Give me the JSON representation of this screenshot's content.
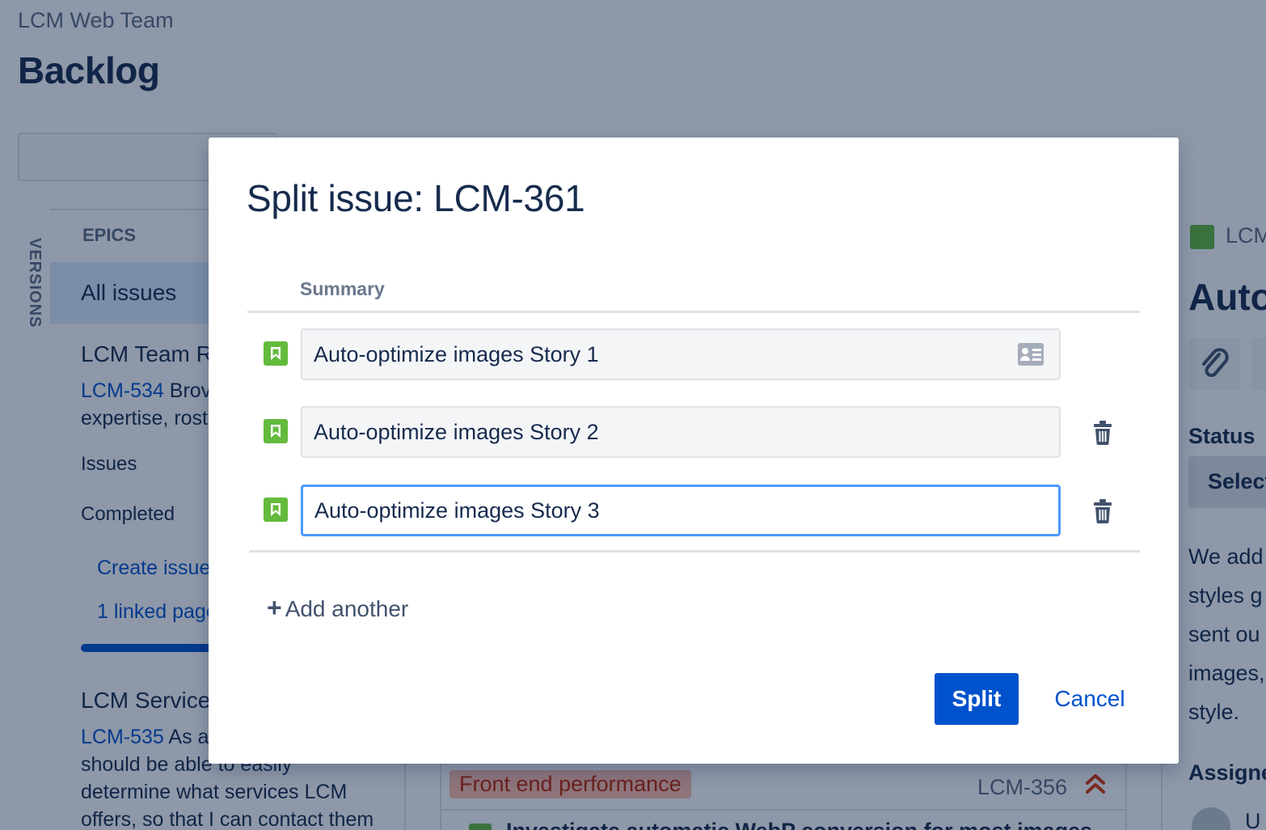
{
  "header": {
    "team": "LCM Web Team",
    "title": "Backlog"
  },
  "sidebar": {
    "versions_tab": "VERSIONS",
    "epics_heading": "EPICS",
    "all_issues": "All issues",
    "epic1": {
      "name": "LCM Team R",
      "key": "LCM-534",
      "desc_rest": " Brov",
      "desc_line2": "expertise, rost",
      "issues_label": "Issues",
      "completed_label": "Completed",
      "create_issue": "Create issue",
      "linked_pages": "1 linked page",
      "progress_fraction": 1.0
    },
    "epic2": {
      "name": "LCM Service",
      "key": "LCM-535",
      "desc_rest": " As a",
      "desc_line2": "should be able to easily",
      "desc_line3": "determine what services LCM",
      "desc_line4": "offers, so that I can contact them"
    }
  },
  "backlog_row": {
    "epic_label": "Front end performance",
    "key": "LCM-356",
    "priority_icon": "highest-priority-icon",
    "next_row_text": "Investigate automatic WebP conversion for most images"
  },
  "detail": {
    "key": "LCM",
    "title": "Auto",
    "status_label": "Status",
    "status_value": "Select",
    "desc_lines": [
      "We add",
      "styles g",
      "sent ou",
      "images,",
      "style."
    ],
    "assignee_label": "Assignee",
    "assignee_name": "U"
  },
  "modal": {
    "title": "Split issue: LCM-361",
    "column_header": "Summary",
    "rows": [
      {
        "value": "Auto-optimize images Story 1",
        "issue_type": "story-icon"
      },
      {
        "value": "Auto-optimize images Story 2",
        "issue_type": "story-icon"
      },
      {
        "value": "Auto-optimize images Story 3",
        "issue_type": "story-icon"
      }
    ],
    "add_another": "Add another",
    "split_label": "Split",
    "cancel_label": "Cancel"
  },
  "colors": {
    "primary": "#0052cc",
    "story": "#63ba3c",
    "focus": "#4c9aff",
    "epic_lozenge_bg": "#ffbdad",
    "epic_lozenge_text": "#bf2600"
  }
}
